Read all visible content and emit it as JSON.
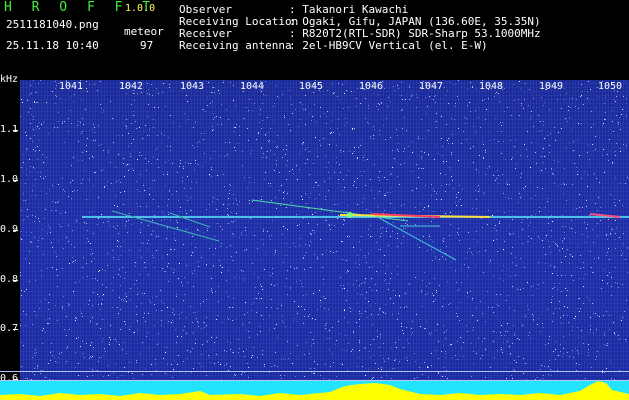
{
  "app": {
    "logo": "H R O F F T",
    "version": "1.0.0"
  },
  "capture": {
    "filename": "2511181040.png",
    "timestamp": "25.11.18 10:40",
    "type_label": "meteor",
    "count": "97"
  },
  "info": {
    "labels": [
      "Observer",
      "Receiving Location",
      "Receiver",
      "Receiving antenna"
    ],
    "values": [
      ": Takanori Kawachi",
      ": Ogaki, Gifu, JAPAN (136.60E, 35.35N)",
      ": R820T2(RTL-SDR) SDR-Sharp 53.1000MHz",
      ": 2el-HB9CV Vertical (el. E-W)"
    ]
  },
  "axes": {
    "y_unit": "kHz",
    "y_ticks": [
      "1.1",
      "1.0",
      "0.9",
      "0.8",
      "0.7",
      "0.6"
    ],
    "x_ticks": [
      "1041",
      "1042",
      "1043",
      "1044",
      "1045",
      "1046",
      "1047",
      "1048",
      "1049",
      "1050"
    ]
  },
  "colors": {
    "background": "#1c2da8",
    "carrier": "#58f0ff",
    "logo": "#3cf03c",
    "activity": "#ffff00",
    "baseline": "#22e4ff"
  }
}
